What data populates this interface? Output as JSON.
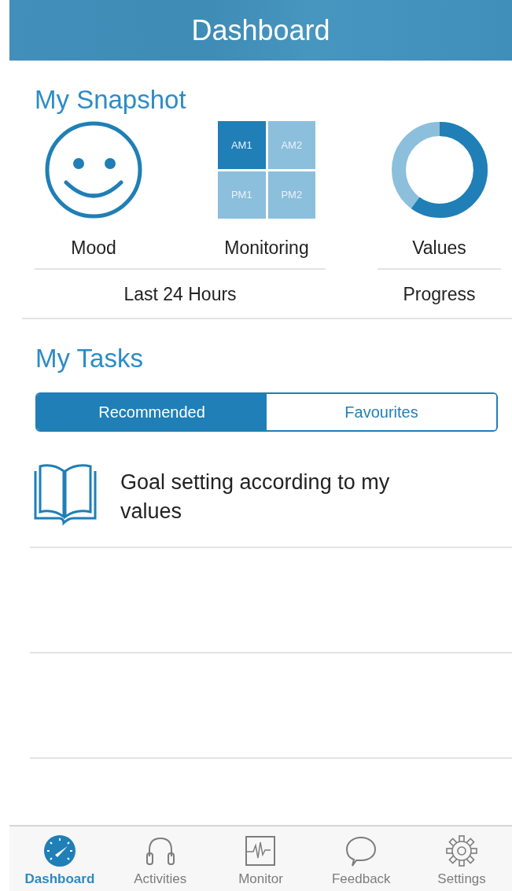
{
  "header": {
    "title": "Dashboard"
  },
  "snapshot": {
    "title": "My Snapshot",
    "groups": [
      {
        "caption": "Last 24 Hours",
        "items": [
          {
            "kind": "mood",
            "label": "Mood"
          },
          {
            "kind": "monitoring",
            "label": "Monitoring",
            "cells": [
              {
                "label": "AM1",
                "filled": true
              },
              {
                "label": "AM2",
                "filled": false
              },
              {
                "label": "PM1",
                "filled": false
              },
              {
                "label": "PM2",
                "filled": false
              }
            ]
          }
        ]
      },
      {
        "caption": "Progress",
        "items": [
          {
            "kind": "progress",
            "label": "Values",
            "level": 0.6
          }
        ]
      }
    ]
  },
  "tasks": {
    "title": "My Tasks",
    "segments": [
      {
        "label": "Recommended",
        "selected": true
      },
      {
        "label": "Favourites",
        "selected": false
      }
    ],
    "items": [
      {
        "text": "Goal setting according to my values"
      }
    ]
  },
  "tab_bar": [
    {
      "label": "Dashboard",
      "kind": "gauge",
      "selected": true
    },
    {
      "label": "Activities",
      "kind": "headphones",
      "selected": false
    },
    {
      "label": "Monitor",
      "kind": "pulse",
      "selected": false
    },
    {
      "label": "Feedback",
      "kind": "bubble",
      "selected": false
    },
    {
      "label": "Settings",
      "kind": "gear",
      "selected": false
    }
  ]
}
